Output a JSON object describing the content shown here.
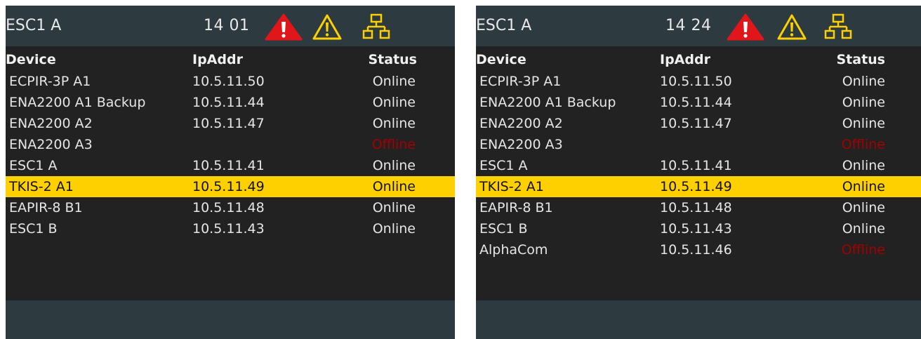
{
  "colors": {
    "header_bg": "#2d3a40",
    "panel_bg": "#222222",
    "selected_row": "#ffd000",
    "offline_text": "#a30000",
    "alarm_red": "#e0161b",
    "warning_yellow": "#ffd000",
    "network_yellow": "#ffd000"
  },
  "icons": [
    "alarm-icon",
    "warning-icon",
    "network-icon"
  ],
  "screens": [
    {
      "title": "ESC1 A",
      "time": "14 01",
      "columns": {
        "device": "Device",
        "ip": "IpAddr",
        "status": "Status"
      },
      "rows": [
        {
          "device": "ECPIR-3P A1",
          "ip": "10.5.11.50",
          "status": "Online"
        },
        {
          "device": "ENA2200 A1 Backup",
          "ip": "10.5.11.44",
          "status": "Online"
        },
        {
          "device": "ENA2200 A2",
          "ip": "10.5.11.47",
          "status": "Online"
        },
        {
          "device": "ENA2200 A3",
          "ip": "",
          "status": "Offline"
        },
        {
          "device": "ESC1 A",
          "ip": "10.5.11.41",
          "status": "Online"
        },
        {
          "device": "TKIS-2 A1",
          "ip": "10.5.11.49",
          "status": "Online",
          "selected": true
        },
        {
          "device": "EAPIR-8 B1",
          "ip": "10.5.11.48",
          "status": "Online"
        },
        {
          "device": "ESC1 B",
          "ip": "10.5.11.43",
          "status": "Online"
        }
      ]
    },
    {
      "title": "ESC1 A",
      "time": "14 24",
      "columns": {
        "device": "Device",
        "ip": "IpAddr",
        "status": "Status"
      },
      "rows": [
        {
          "device": "ECPIR-3P A1",
          "ip": "10.5.11.50",
          "status": "Online"
        },
        {
          "device": "ENA2200 A1 Backup",
          "ip": "10.5.11.44",
          "status": "Online"
        },
        {
          "device": "ENA2200 A2",
          "ip": "10.5.11.47",
          "status": "Online"
        },
        {
          "device": "ENA2200 A3",
          "ip": "",
          "status": "Offline"
        },
        {
          "device": "ESC1 A",
          "ip": "10.5.11.41",
          "status": "Online"
        },
        {
          "device": "TKIS-2 A1",
          "ip": "10.5.11.49",
          "status": "Online",
          "selected": true
        },
        {
          "device": "EAPIR-8 B1",
          "ip": "10.5.11.48",
          "status": "Online"
        },
        {
          "device": "ESC1 B",
          "ip": "10.5.11.43",
          "status": "Online"
        },
        {
          "device": "AlphaCom",
          "ip": "10.5.11.46",
          "status": "Offline"
        }
      ]
    }
  ]
}
